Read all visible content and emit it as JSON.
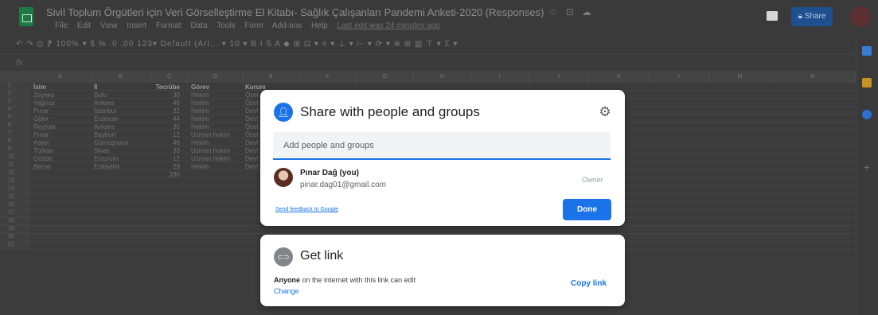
{
  "app": {
    "doc_title": "Sivil Toplum Örgütleri için Veri Görselleştirme El Kitabı- Sağlık Çalışanları Pandemi Anketi-2020 (Responses)",
    "menu": [
      "File",
      "Edit",
      "View",
      "Insert",
      "Format",
      "Data",
      "Tools",
      "Form",
      "Add-ons",
      "Help"
    ],
    "last_edit": "Last edit was 24 minutes ago",
    "share_label": "Share",
    "toolbar_text": "↶ ↷ ⎙ ⁋   100% ▾   $  %  .0  .00  123▾   Default (Ari... ▾   10  ▾   B  I  S  A   ◆  ⊞  ⊡ ▾   ≡ ▾  ⊥ ▾  ⊢ ▾  ⟳ ▾   ⊕  ⊞  ▥  ⊤ ▾  Σ ▾",
    "fx": "fx"
  },
  "sheet": {
    "columns": [
      "A",
      "B",
      "C",
      "D",
      "E",
      "F",
      "G",
      "H",
      "I",
      "J",
      "K",
      "L",
      "M",
      "N"
    ],
    "header_row": [
      "İsim",
      "İl",
      "Tecrübe",
      "Görev",
      "Kurum"
    ],
    "rows": [
      [
        "Zeynep",
        "Bolu",
        "30",
        "Hekim",
        "Özel"
      ],
      [
        "Yağmur",
        "Ankara",
        "45",
        "Hekim",
        "Özel"
      ],
      [
        "Pınar",
        "İstanbul",
        "32",
        "Hekim",
        "Devl"
      ],
      [
        "Güler",
        "Erzincan",
        "44",
        "Hekim",
        "Devl"
      ],
      [
        "Reyhan",
        "Ankara",
        "35",
        "Hekim",
        "Özel"
      ],
      [
        "Pınar",
        "Bayburt",
        "12",
        "Uzman hekim",
        "Özel"
      ],
      [
        "Aslan",
        "Gümüşhane",
        "46",
        "Hekim",
        "Devl"
      ],
      [
        "Türkan",
        "Sivas",
        "33",
        "Uzman hekim",
        "Devl"
      ],
      [
        "Gözde",
        "Erzurum",
        "12",
        "Uzman hekim",
        "Devl"
      ],
      [
        "Berna",
        "Eskişehir",
        "29",
        "Hekim",
        "Devl"
      ]
    ],
    "total": "330",
    "row_numbers": [
      "1",
      "2",
      "3",
      "4",
      "5",
      "6",
      "7",
      "8",
      "9",
      "10",
      "11",
      "12",
      "13",
      "14",
      "15",
      "16",
      "17",
      "18",
      "19",
      "20",
      "21"
    ]
  },
  "share_dialog": {
    "title": "Share with people and groups",
    "icon": "person-add-icon",
    "add_placeholder": "Add people and groups",
    "person_name": "Pınar Dağ (you)",
    "person_email": "pinar.dag01@gmail.com",
    "role": "Owner",
    "feedback_link": "Send feedback to Google",
    "done_label": "Done"
  },
  "link_dialog": {
    "title": "Get link",
    "icon": "link-icon",
    "desc_bold": "Anyone",
    "desc_rest": " on the internet with this link can edit",
    "change_label": "Change",
    "copy_label": "Copy link"
  },
  "colors": {
    "accent": "#1a73e8",
    "sheets_green": "#1e7a45",
    "overlay": "#3c3c3c"
  }
}
